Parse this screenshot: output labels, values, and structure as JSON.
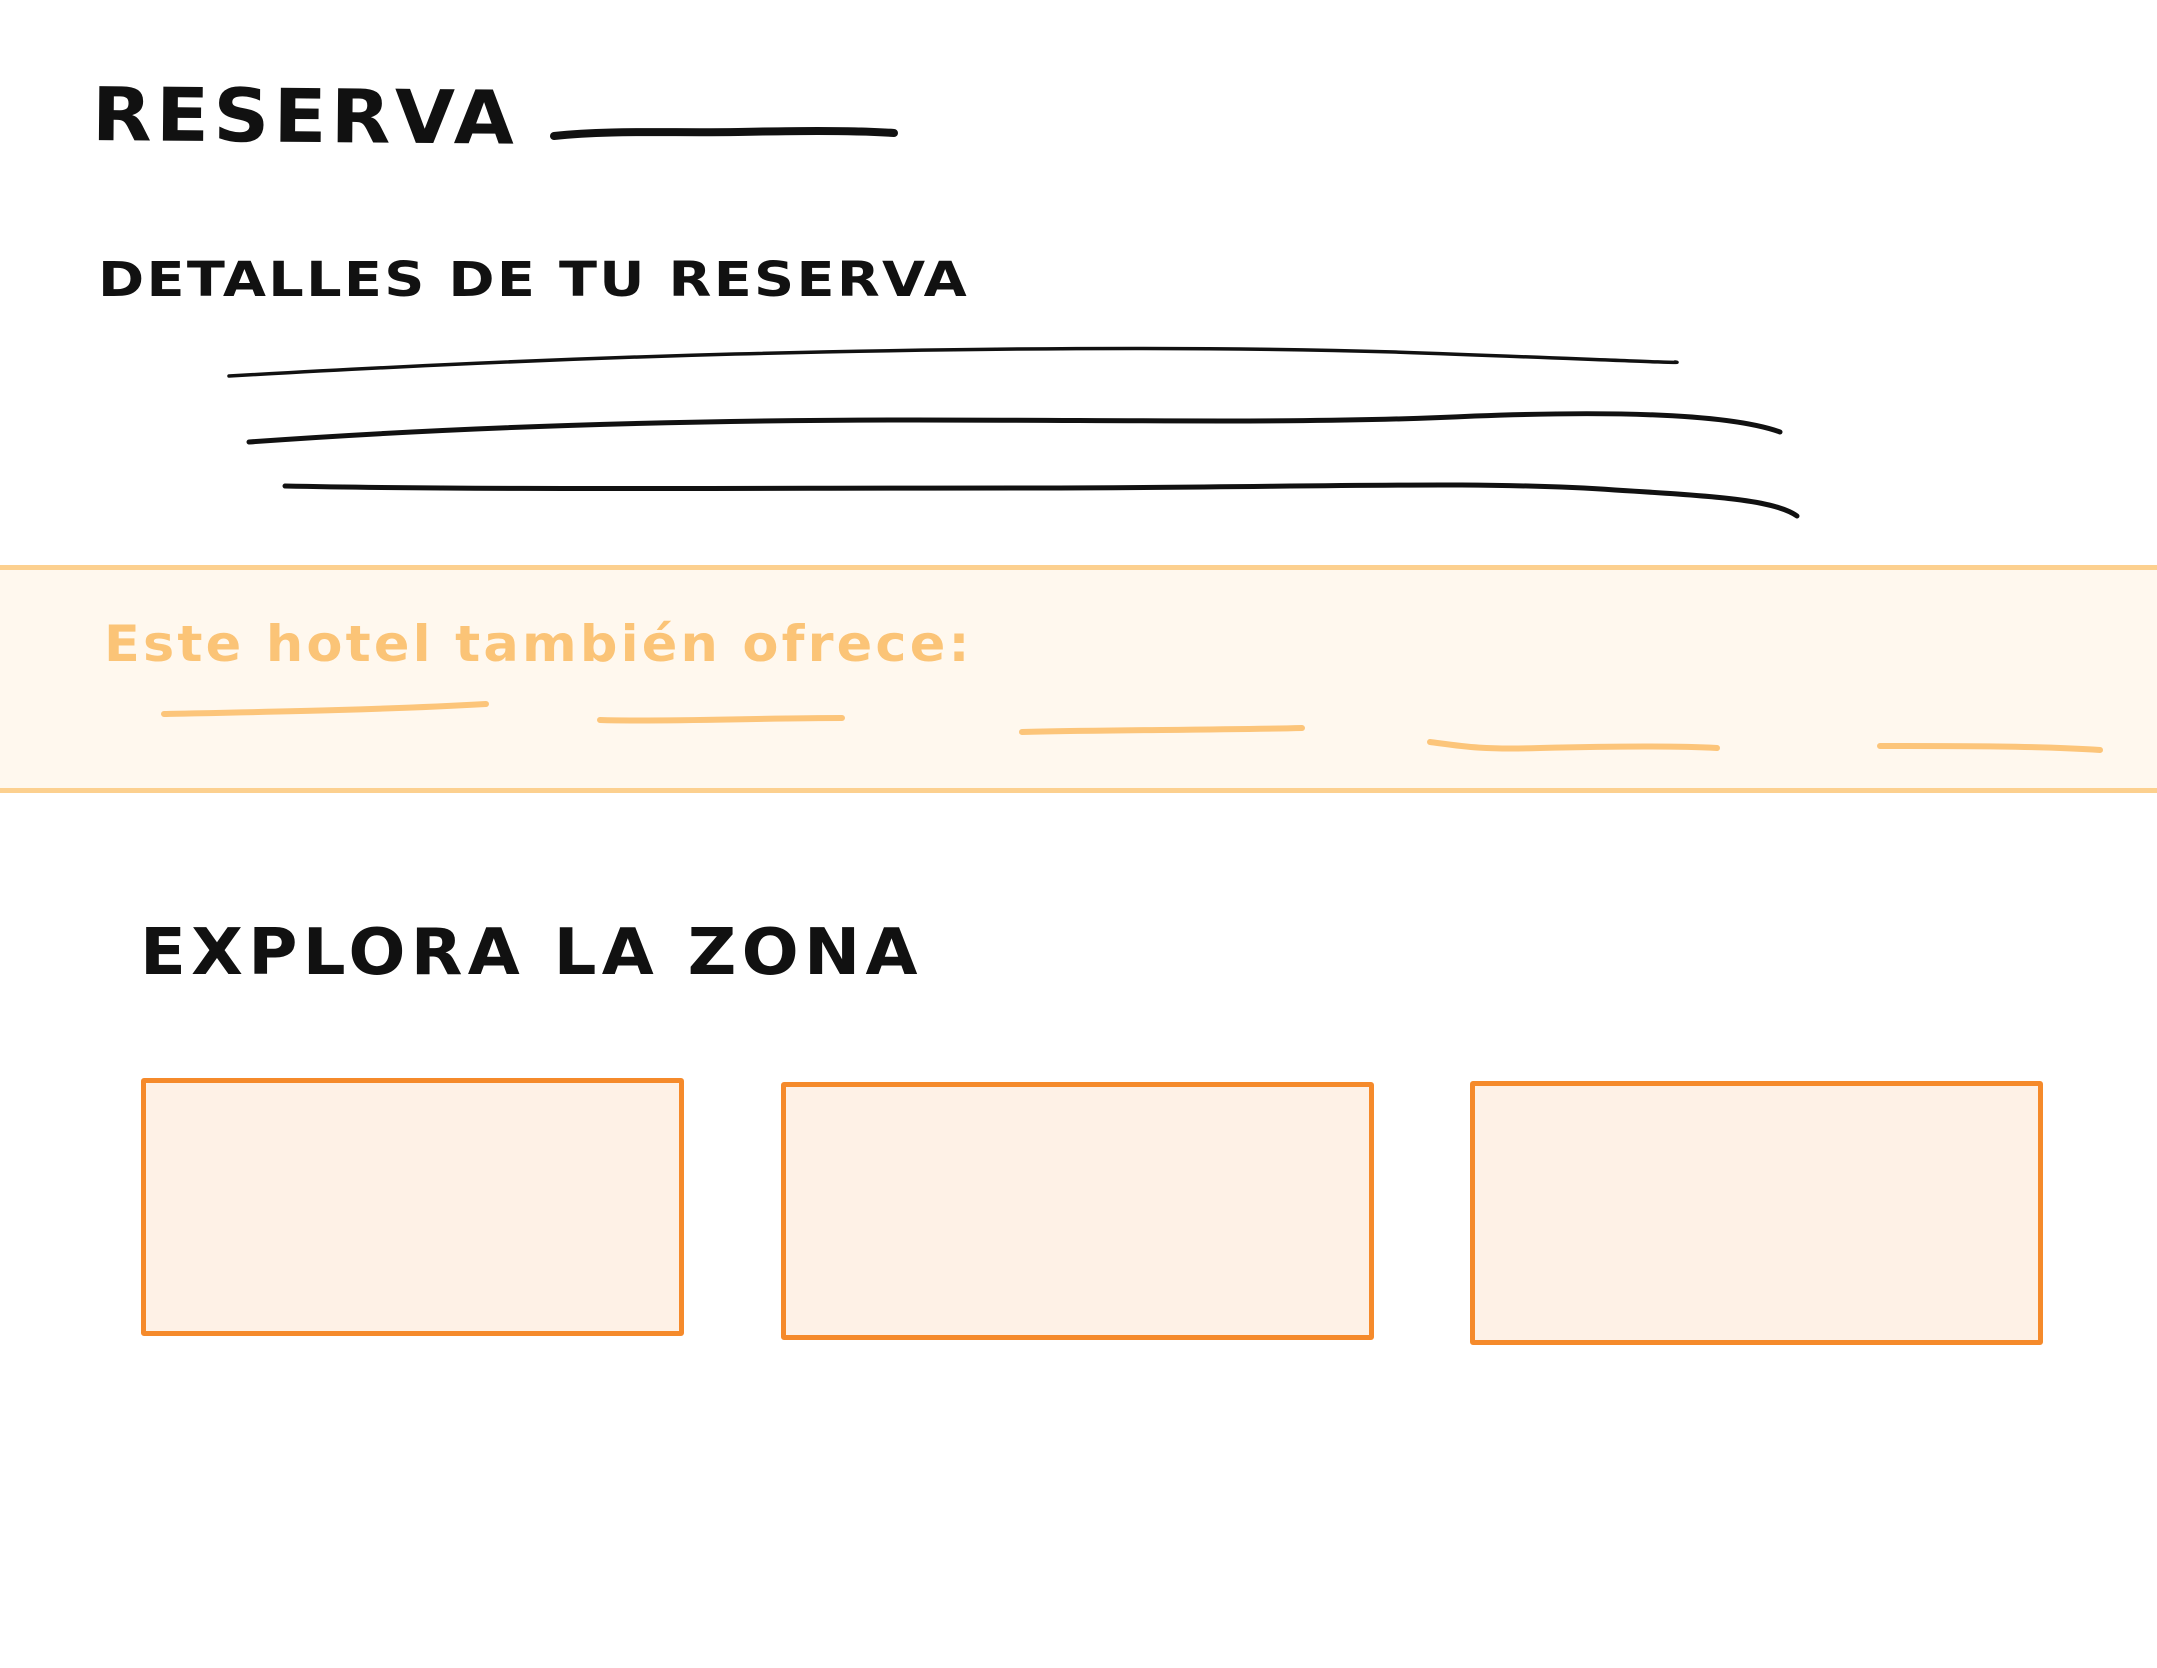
{
  "booking": {
    "title": "Reserva",
    "details_heading": "Detalles de tu reserva"
  },
  "offers": {
    "heading": "Este hotel también ofrece:"
  },
  "explore": {
    "heading": "Explora la zona",
    "cards": [
      {},
      {},
      {}
    ]
  },
  "colors": {
    "ink": "#111111",
    "accent_orange": "#f58a2b",
    "card_fill": "#fef1e6",
    "band_fill": "#fff8ee",
    "band_border": "#fcd08f",
    "band_text": "#fbc477"
  }
}
